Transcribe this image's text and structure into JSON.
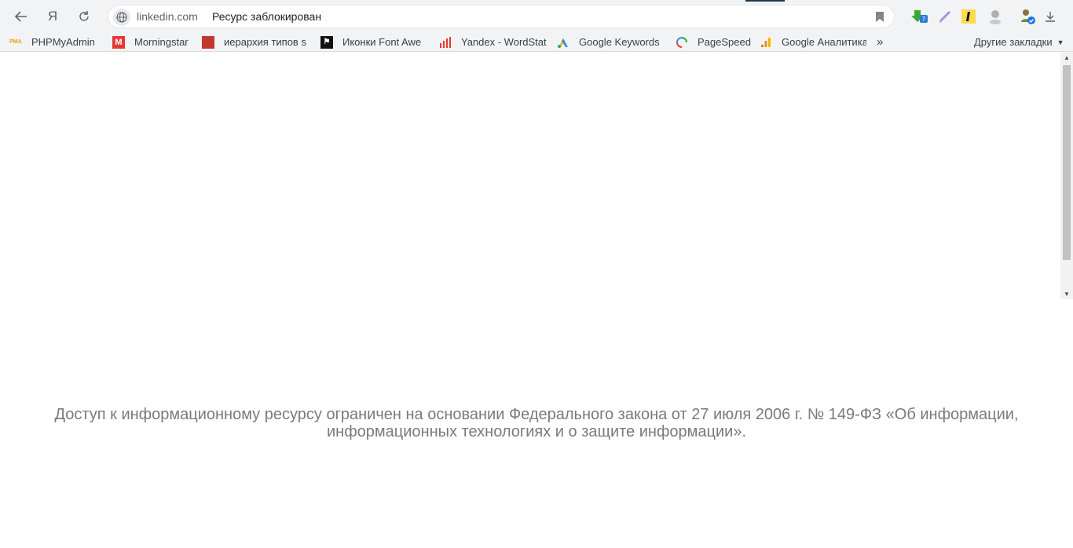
{
  "browser": {
    "nav": {
      "back_icon": "arrow-left-icon",
      "yandex_label": "Я",
      "reload_icon": "reload-icon"
    },
    "omnibox": {
      "domain": "linkedin.com",
      "page_title": "Ресурс заблокирован"
    },
    "extensions": [
      {
        "name": "savefrom-icon"
      },
      {
        "name": "pen-icon"
      },
      {
        "name": "yandex-translate-icon"
      },
      {
        "name": "user-icon"
      },
      {
        "name": "profile-icon"
      },
      {
        "name": "download-icon"
      }
    ]
  },
  "bookmarks": {
    "items": [
      {
        "label": "PHPMyAdmin",
        "icon_text": "PMA",
        "color": "#f39c12"
      },
      {
        "label": "Morningstar",
        "icon_text": "M",
        "color": "#e53935"
      },
      {
        "label": "иерархия типов s",
        "icon_text": "",
        "color": "#c0392b"
      },
      {
        "label": "Иконки Font Awe",
        "icon_text": "",
        "color": "#111111"
      },
      {
        "label": "Yandex - WordStat",
        "icon_text": "",
        "color": "#e53935"
      },
      {
        "label": "Google Keywords",
        "icon_text": "",
        "color": "#4285f4"
      },
      {
        "label": "PageSpeed",
        "icon_text": "",
        "color": "#34a853"
      },
      {
        "label": "Google Аналитика",
        "icon_text": "",
        "color": "#f4b400"
      }
    ],
    "more_label": "»",
    "other_label": "Другие закладки"
  },
  "page": {
    "notice_line1": "Доступ к информационному ресурсу ограничен на основании Федерального закона от 27 июля 2006 г. № 149-ФЗ «Об информации,",
    "notice_line2": "информационных технологиях и о защите информации»."
  }
}
